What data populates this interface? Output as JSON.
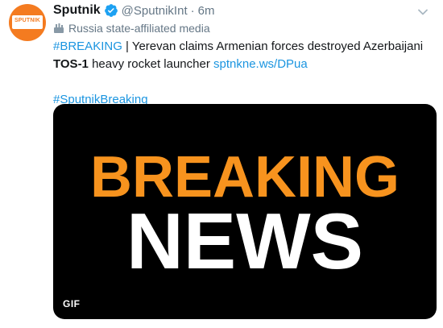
{
  "account": {
    "name": "Sputnik",
    "handle": "@SputnikInt",
    "time": "6m",
    "avatar_text": "SPUTNIK",
    "label": "Russia state-affiliated media"
  },
  "tweet": {
    "hashtag_breaking": "#BREAKING",
    "line1_rest": " | Yerevan claims Armenian forces destroyed Azerbaijani",
    "bold_word": "TOS-1",
    "line2_rest": " heavy rocket launcher ",
    "link": "sptnkne.ws/DPua",
    "hashtag_footer": "#SputnikBreaking"
  },
  "media": {
    "word1": "BREAKING",
    "word2": "NEWS",
    "badge": "GIF"
  },
  "colors": {
    "link_blue": "#1b95e0",
    "verified_blue": "#1da1f2",
    "brand_orange": "#f47b20",
    "breaking_orange": "#f7931e"
  }
}
